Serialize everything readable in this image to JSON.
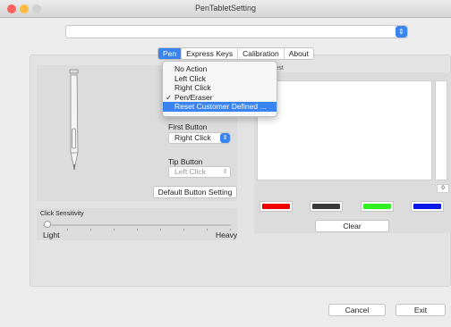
{
  "window": {
    "title": "PenTabletSetting",
    "traffic_lights": [
      "#fc615d",
      "#fdbc40",
      "#d0d0d0"
    ]
  },
  "device_select": {
    "value": "",
    "arrow_icon": "up-down-chevron-icon"
  },
  "tabs": [
    {
      "label": "Pen",
      "active": true
    },
    {
      "label": "Express Keys",
      "active": false
    },
    {
      "label": "Calibration",
      "active": false
    },
    {
      "label": "About",
      "active": false
    }
  ],
  "pen": {
    "first_button_label": "First Button",
    "first_button_value": "Right Click",
    "tip_button_label": "Tip Button",
    "tip_button_value": "Left Click",
    "default_button": "Default  Button Setting"
  },
  "click_sensitivity": {
    "label": "Click Sensitivity",
    "min_label": "Light",
    "max_label": "Heavy",
    "level_fraction": 0.0
  },
  "test": {
    "title": "Test",
    "pressure_readout": "0",
    "colors": [
      "#ee0000",
      "#3a3a3a",
      "#33ee22",
      "#0a18e8"
    ],
    "clear_label": "Clear"
  },
  "dropdown_menu": {
    "items": [
      {
        "label": "No Action",
        "checked": false,
        "highlighted": false
      },
      {
        "label": "Left Click",
        "checked": false,
        "highlighted": false
      },
      {
        "label": "Right Click",
        "checked": false,
        "highlighted": false
      },
      {
        "label": "Pen/Eraser",
        "checked": true,
        "highlighted": false
      },
      {
        "label": "Reset Customer Defined ...",
        "checked": false,
        "highlighted": true
      }
    ],
    "check_mark": "✓"
  },
  "footer": {
    "cancel_label": "Cancel",
    "exit_label": "Exit"
  }
}
